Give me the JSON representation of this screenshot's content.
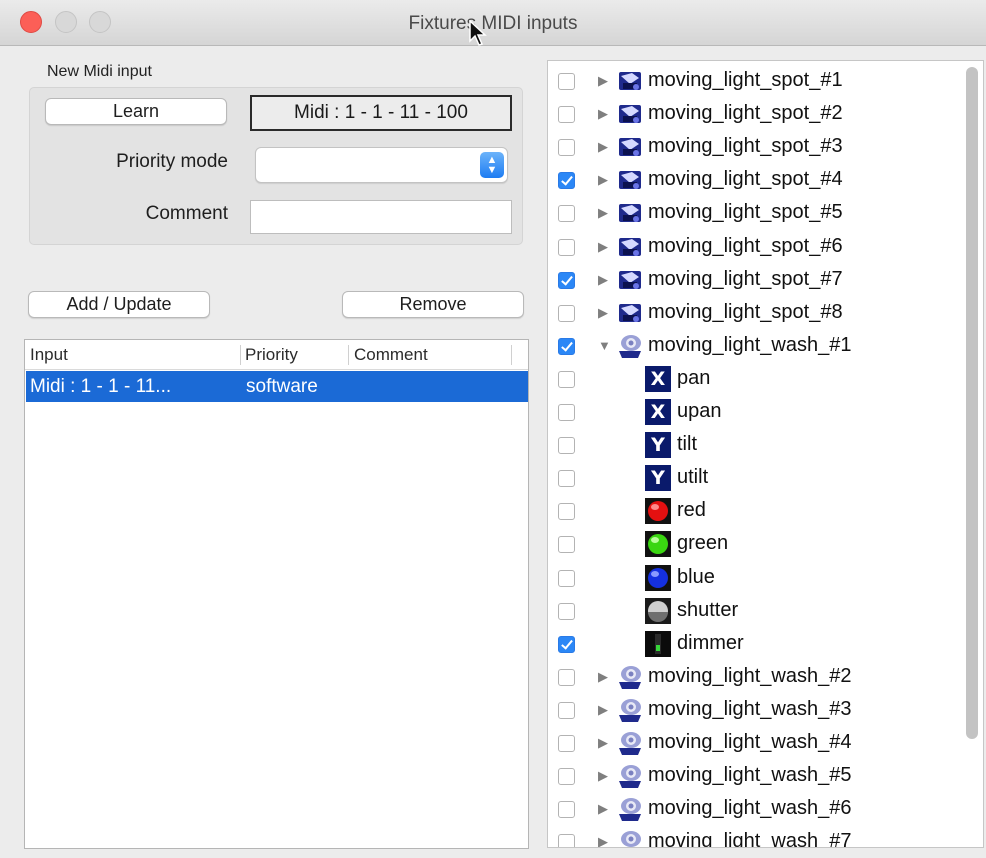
{
  "window": {
    "title": "Fixtures MIDI inputs"
  },
  "new_input": {
    "group_label": "New Midi input",
    "learn_label": "Learn",
    "midi_value": "Midi : 1 - 1 - 11 - 100",
    "priority_label": "Priority mode",
    "priority_value": "",
    "comment_label": "Comment",
    "comment_value": ""
  },
  "actions": {
    "add_label": "Add / Update",
    "remove_label": "Remove"
  },
  "table": {
    "headers": [
      "Input",
      "Priority",
      "Comment"
    ],
    "rows": [
      {
        "input": "Midi : 1 - 1 - 11...",
        "priority": "software",
        "comment": ""
      }
    ]
  },
  "tree": {
    "items": [
      {
        "label": "moving_light_spot_#1",
        "checked": false,
        "kind": "spot",
        "level": 0,
        "expanded": false
      },
      {
        "label": "moving_light_spot_#2",
        "checked": false,
        "kind": "spot",
        "level": 0,
        "expanded": false
      },
      {
        "label": "moving_light_spot_#3",
        "checked": false,
        "kind": "spot",
        "level": 0,
        "expanded": false
      },
      {
        "label": "moving_light_spot_#4",
        "checked": true,
        "kind": "spot",
        "level": 0,
        "expanded": false
      },
      {
        "label": "moving_light_spot_#5",
        "checked": false,
        "kind": "spot",
        "level": 0,
        "expanded": false
      },
      {
        "label": "moving_light_spot_#6",
        "checked": false,
        "kind": "spot",
        "level": 0,
        "expanded": false
      },
      {
        "label": "moving_light_spot_#7",
        "checked": true,
        "kind": "spot",
        "level": 0,
        "expanded": false
      },
      {
        "label": "moving_light_spot_#8",
        "checked": false,
        "kind": "spot",
        "level": 0,
        "expanded": false
      },
      {
        "label": "moving_light_wash_#1",
        "checked": true,
        "kind": "wash",
        "level": 0,
        "expanded": true
      },
      {
        "label": "pan",
        "checked": false,
        "kind": "pan",
        "level": 1
      },
      {
        "label": "upan",
        "checked": false,
        "kind": "upan",
        "level": 1
      },
      {
        "label": "tilt",
        "checked": false,
        "kind": "tilt",
        "level": 1
      },
      {
        "label": "utilt",
        "checked": false,
        "kind": "utilt",
        "level": 1
      },
      {
        "label": "red",
        "checked": false,
        "kind": "red",
        "level": 1
      },
      {
        "label": "green",
        "checked": false,
        "kind": "green",
        "level": 1
      },
      {
        "label": "blue",
        "checked": false,
        "kind": "blue",
        "level": 1
      },
      {
        "label": "shutter",
        "checked": false,
        "kind": "shutter",
        "level": 1
      },
      {
        "label": "dimmer",
        "checked": true,
        "kind": "dimmer",
        "level": 1
      },
      {
        "label": "moving_light_wash_#2",
        "checked": false,
        "kind": "wash",
        "level": 0,
        "expanded": false
      },
      {
        "label": "moving_light_wash_#3",
        "checked": false,
        "kind": "wash",
        "level": 0,
        "expanded": false
      },
      {
        "label": "moving_light_wash_#4",
        "checked": false,
        "kind": "wash",
        "level": 0,
        "expanded": false
      },
      {
        "label": "moving_light_wash_#5",
        "checked": false,
        "kind": "wash",
        "level": 0,
        "expanded": false
      },
      {
        "label": "moving_light_wash_#6",
        "checked": false,
        "kind": "wash",
        "level": 0,
        "expanded": false
      },
      {
        "label": "moving_light_wash_#7",
        "checked": false,
        "kind": "wash",
        "level": 0,
        "expanded": false
      }
    ]
  },
  "colors": {
    "selection": "#1b6ad6",
    "checkbox_checked": "#2b87f6",
    "close_button": "#fc5f57"
  }
}
